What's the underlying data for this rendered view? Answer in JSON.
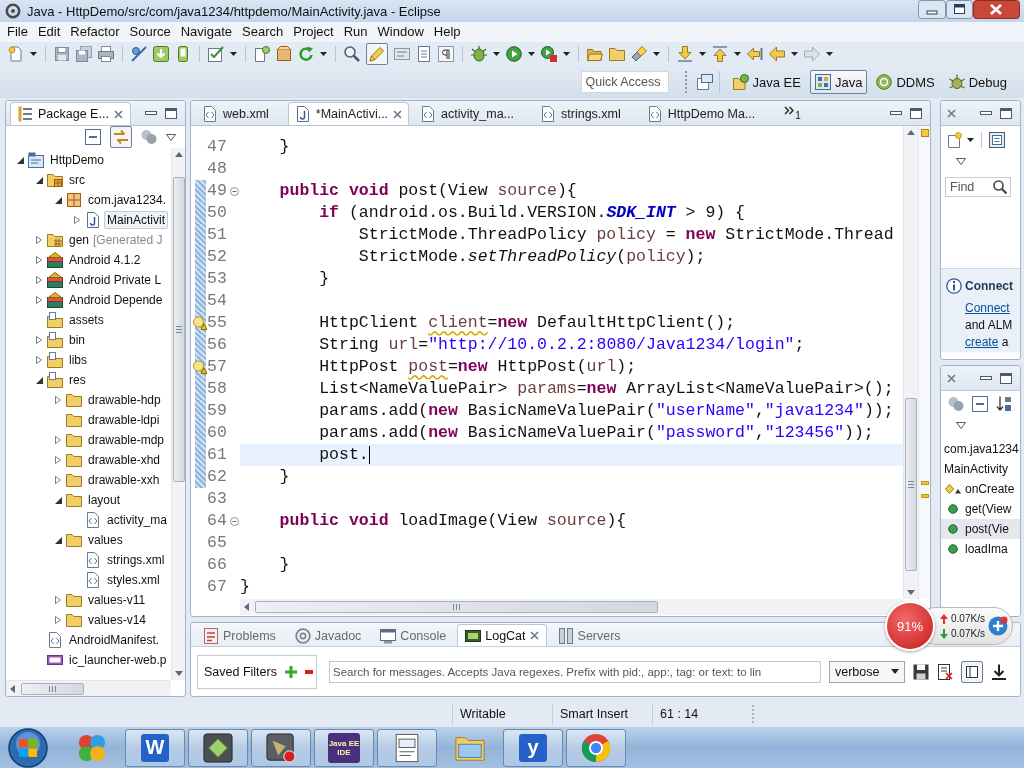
{
  "window": {
    "title": "Java - HttpDemo/src/com/java1234/httpdemo/MainActivity.java - Eclipse"
  },
  "menu": [
    "File",
    "Edit",
    "Refactor",
    "Source",
    "Navigate",
    "Search",
    "Project",
    "Run",
    "Window",
    "Help"
  ],
  "toolbar": {
    "toggle_on": true
  },
  "quick_access": {
    "placeholder": "Quick Access"
  },
  "perspectives": [
    {
      "label": "Java EE",
      "kind": "javaee",
      "selected": false
    },
    {
      "label": "Java",
      "kind": "java",
      "selected": true
    },
    {
      "label": "DDMS",
      "kind": "ddms",
      "selected": false
    },
    {
      "label": "Debug",
      "kind": "debug",
      "selected": false
    }
  ],
  "package_explorer": {
    "title": "Package E...",
    "link_toggle_on": true,
    "tree": [
      {
        "label": "HttpDemo",
        "kind": "project",
        "expanded": true,
        "selected": false,
        "children": [
          {
            "label": "src",
            "kind": "source-folder",
            "expanded": true,
            "selected": false,
            "children": [
              {
                "label": "com.java1234.",
                "kind": "package",
                "expanded": true,
                "selected": false,
                "children": [
                  {
                    "label": "MainActivit",
                    "kind": "java-file",
                    "expanded": false,
                    "selected": true
                  }
                ]
              }
            ]
          },
          {
            "label": "gen",
            "note": "[Generated J",
            "kind": "generated-folder",
            "expanded": false,
            "selected": false
          },
          {
            "label": "Android 4.1.2",
            "kind": "library",
            "expanded": false,
            "selected": false
          },
          {
            "label": "Android Private L",
            "kind": "library",
            "expanded": false,
            "selected": false
          },
          {
            "label": "Android Depende",
            "kind": "library",
            "expanded": false,
            "selected": false
          },
          {
            "label": "assets",
            "kind": "resource-folder",
            "selected": false
          },
          {
            "label": "bin",
            "kind": "resource-folder",
            "expanded": false,
            "selected": false
          },
          {
            "label": "libs",
            "kind": "resource-folder",
            "expanded": false,
            "selected": false
          },
          {
            "label": "res",
            "kind": "resource-folder",
            "expanded": true,
            "selected": false,
            "children": [
              {
                "label": "drawable-hdp",
                "kind": "folder",
                "expanded": false,
                "selected": false
              },
              {
                "label": "drawable-ldpi",
                "kind": "folder",
                "selected": false
              },
              {
                "label": "drawable-mdp",
                "kind": "folder",
                "expanded": false,
                "selected": false
              },
              {
                "label": "drawable-xhd",
                "kind": "folder",
                "expanded": false,
                "selected": false
              },
              {
                "label": "drawable-xxh",
                "kind": "folder",
                "expanded": false,
                "selected": false
              },
              {
                "label": "layout",
                "kind": "folder",
                "expanded": true,
                "selected": false,
                "children": [
                  {
                    "label": "activity_ma",
                    "kind": "xml-file",
                    "selected": false
                  }
                ]
              },
              {
                "label": "values",
                "kind": "folder",
                "expanded": true,
                "selected": false,
                "children": [
                  {
                    "label": "strings.xml",
                    "kind": "xml-file",
                    "selected": false
                  },
                  {
                    "label": "styles.xml",
                    "kind": "xml-file",
                    "selected": false
                  }
                ]
              },
              {
                "label": "values-v11",
                "kind": "folder",
                "expanded": false,
                "selected": false
              },
              {
                "label": "values-v14",
                "kind": "folder",
                "expanded": false,
                "selected": false
              }
            ]
          },
          {
            "label": "AndroidManifest.",
            "kind": "xml-file",
            "selected": false
          },
          {
            "label": "ic_launcher-web.p",
            "kind": "png-file",
            "selected": false
          }
        ]
      }
    ]
  },
  "editor": {
    "tabs": [
      {
        "label": "web.xml",
        "kind": "xml",
        "selected": false
      },
      {
        "label": "*MainActivi...",
        "kind": "java",
        "selected": true
      },
      {
        "label": "activity_ma...",
        "kind": "xml",
        "selected": false
      },
      {
        "label": "strings.xml",
        "kind": "xml",
        "selected": false
      },
      {
        "label": "HttpDemo Ma...",
        "kind": "xml",
        "selected": false
      }
    ],
    "overflow_count": "1",
    "lines": [
      {
        "number": "47",
        "changed": false,
        "foldable": false,
        "warning": false,
        "current": false,
        "segments": [
          {
            "kind": "plain",
            "text": "    }"
          }
        ]
      },
      {
        "number": "48",
        "changed": false,
        "foldable": false,
        "warning": false,
        "current": false
      },
      {
        "number": "49",
        "changed": true,
        "foldable": true,
        "warning": false,
        "current": false,
        "segments": [
          {
            "kind": "keyword",
            "text": "    public void"
          },
          {
            "kind": "plain",
            "text": " post(View "
          },
          {
            "kind": "variable",
            "text": "source"
          },
          {
            "kind": "plain",
            "text": "){"
          }
        ]
      },
      {
        "number": "50",
        "changed": true,
        "foldable": false,
        "warning": false,
        "current": false,
        "segments": [
          {
            "kind": "keyword",
            "text": "        if"
          },
          {
            "kind": "plain",
            "text": " (android.os.Build.VERSION."
          },
          {
            "kind": "constant",
            "text": "SDK_INT"
          },
          {
            "kind": "plain",
            "text": " > 9) {"
          }
        ]
      },
      {
        "number": "51",
        "changed": true,
        "foldable": false,
        "warning": false,
        "current": false,
        "segments": [
          {
            "kind": "plain",
            "text": "            StrictMode.ThreadPolicy "
          },
          {
            "kind": "variable",
            "text": "policy"
          },
          {
            "kind": "plain",
            "text": " = "
          },
          {
            "kind": "keyword",
            "text": "new"
          },
          {
            "kind": "plain",
            "text": " StrictMode.Thread"
          }
        ]
      },
      {
        "number": "52",
        "changed": true,
        "foldable": false,
        "warning": false,
        "current": false,
        "segments": [
          {
            "kind": "plain",
            "text": "            StrictMode."
          },
          {
            "kind": "static-call",
            "text": "setThreadPolicy"
          },
          {
            "kind": "plain",
            "text": "("
          },
          {
            "kind": "variable",
            "text": "policy"
          },
          {
            "kind": "plain",
            "text": ");"
          }
        ]
      },
      {
        "number": "53",
        "changed": true,
        "foldable": false,
        "warning": false,
        "current": false,
        "segments": [
          {
            "kind": "plain",
            "text": "        }"
          }
        ]
      },
      {
        "number": "54",
        "changed": true,
        "foldable": false,
        "warning": false,
        "current": false
      },
      {
        "number": "55",
        "changed": true,
        "foldable": false,
        "warning": true,
        "current": false,
        "segments": [
          {
            "kind": "plain",
            "text": "        HttpClient "
          },
          {
            "kind": "flagged-variable",
            "text": "client"
          },
          {
            "kind": "plain",
            "text": "="
          },
          {
            "kind": "keyword",
            "text": "new"
          },
          {
            "kind": "plain",
            "text": " DefaultHttpClient();"
          }
        ]
      },
      {
        "number": "56",
        "changed": true,
        "foldable": false,
        "warning": false,
        "current": false,
        "segments": [
          {
            "kind": "plain",
            "text": "        String "
          },
          {
            "kind": "variable",
            "text": "url"
          },
          {
            "kind": "plain",
            "text": "="
          },
          {
            "kind": "string",
            "text": "\"http://10.0.2.2:8080/Java1234/login\""
          },
          {
            "kind": "plain",
            "text": ";"
          }
        ]
      },
      {
        "number": "57",
        "changed": true,
        "foldable": false,
        "warning": true,
        "current": false,
        "segments": [
          {
            "kind": "plain",
            "text": "        HttpPost "
          },
          {
            "kind": "flagged-variable",
            "text": "post"
          },
          {
            "kind": "plain",
            "text": "="
          },
          {
            "kind": "keyword",
            "text": "new"
          },
          {
            "kind": "plain",
            "text": " HttpPost("
          },
          {
            "kind": "variable",
            "text": "url"
          },
          {
            "kind": "plain",
            "text": ");"
          }
        ]
      },
      {
        "number": "58",
        "changed": true,
        "foldable": false,
        "warning": false,
        "current": false,
        "segments": [
          {
            "kind": "plain",
            "text": "        List<NameValuePair> "
          },
          {
            "kind": "variable",
            "text": "params"
          },
          {
            "kind": "plain",
            "text": "="
          },
          {
            "kind": "keyword",
            "text": "new"
          },
          {
            "kind": "plain",
            "text": " ArrayList<NameValuePair>();"
          }
        ]
      },
      {
        "number": "59",
        "changed": true,
        "foldable": false,
        "warning": false,
        "current": false,
        "segments": [
          {
            "kind": "plain",
            "text": "        params.add("
          },
          {
            "kind": "keyword",
            "text": "new"
          },
          {
            "kind": "plain",
            "text": " BasicNameValuePair("
          },
          {
            "kind": "string",
            "text": "\"userName\""
          },
          {
            "kind": "plain",
            "text": ","
          },
          {
            "kind": "string",
            "text": "\"java1234\""
          },
          {
            "kind": "plain",
            "text": "));"
          }
        ]
      },
      {
        "number": "60",
        "changed": true,
        "foldable": false,
        "warning": false,
        "current": false,
        "segments": [
          {
            "kind": "plain",
            "text": "        params.add("
          },
          {
            "kind": "keyword",
            "text": "new"
          },
          {
            "kind": "plain",
            "text": " BasicNameValuePair("
          },
          {
            "kind": "string",
            "text": "\"password\""
          },
          {
            "kind": "plain",
            "text": ","
          },
          {
            "kind": "string",
            "text": "\"123456\""
          },
          {
            "kind": "plain",
            "text": "));"
          }
        ]
      },
      {
        "number": "61",
        "changed": true,
        "foldable": false,
        "warning": false,
        "current": true,
        "segments": [
          {
            "kind": "plain",
            "text": "        post."
          }
        ]
      },
      {
        "number": "62",
        "changed": true,
        "foldable": false,
        "warning": false,
        "current": false,
        "segments": [
          {
            "kind": "plain",
            "text": "    }"
          }
        ]
      },
      {
        "number": "63",
        "changed": false,
        "foldable": false,
        "warning": false,
        "current": false
      },
      {
        "number": "64",
        "changed": false,
        "foldable": true,
        "warning": false,
        "current": false,
        "segments": [
          {
            "kind": "keyword",
            "text": "    public void"
          },
          {
            "kind": "plain",
            "text": " loadImage(View "
          },
          {
            "kind": "variable",
            "text": "source"
          },
          {
            "kind": "plain",
            "text": "){"
          }
        ]
      },
      {
        "number": "65",
        "changed": false,
        "foldable": false,
        "warning": false,
        "current": false
      },
      {
        "number": "66",
        "changed": false,
        "foldable": false,
        "warning": false,
        "current": false,
        "segments": [
          {
            "kind": "plain",
            "text": "    }"
          }
        ]
      },
      {
        "number": "67",
        "changed": false,
        "foldable": false,
        "warning": false,
        "current": false,
        "segments": [
          {
            "kind": "plain",
            "text": "}"
          }
        ]
      }
    ]
  },
  "tasks_view": {
    "find_placeholder": "Find",
    "connect": {
      "heading": "Connect",
      "lines": [
        [
          {
            "text": "Connect",
            "link": true
          }
        ],
        [
          {
            "text": "and ALM",
            "link": false
          }
        ],
        [
          {
            "text": "create",
            "link": true
          },
          {
            "text": "a",
            "link": false
          }
        ]
      ]
    }
  },
  "outline": {
    "items": [
      {
        "label": "com.java1234",
        "kind": "text",
        "selected": false
      },
      {
        "label": "MainActivity",
        "kind": "text",
        "selected": false
      },
      {
        "label": "onCreate",
        "kind": "override-method",
        "selected": false
      },
      {
        "label": "get(View",
        "kind": "method",
        "selected": false
      },
      {
        "label": "post(Vie",
        "kind": "method",
        "selected": true
      },
      {
        "label": "loadIma",
        "kind": "method",
        "selected": false
      }
    ]
  },
  "bottom_panel": {
    "tabs": [
      {
        "label": "Problems",
        "kind": "problems",
        "selected": false
      },
      {
        "label": "Javadoc",
        "kind": "javadoc",
        "selected": false
      },
      {
        "label": "Console",
        "kind": "console",
        "selected": false
      },
      {
        "label": "LogCat",
        "kind": "logcat",
        "selected": true
      },
      {
        "label": "Servers",
        "kind": "servers",
        "selected": false
      }
    ],
    "logcat": {
      "saved_filters": "Saved Filters",
      "search_placeholder": "Search for messages. Accepts Java regexes. Prefix with pid:, app:, tag: or text: to lin",
      "level": "verbose",
      "pane_toggle_on": true
    }
  },
  "status_bar": [
    "Writable",
    "Smart Insert",
    "61 : 14"
  ],
  "speed_widget": {
    "percent": "91%",
    "upload": "0.07K/s",
    "download": "0.07K/s"
  },
  "taskbar": {
    "apps": [
      {
        "kind": "circles",
        "running": false
      },
      {
        "kind": "letter",
        "label": "W",
        "running": true
      },
      {
        "kind": "slate-diamond",
        "running": true
      },
      {
        "kind": "slate-dot",
        "running": true
      },
      {
        "kind": "badge",
        "label": "Java EE IDE",
        "running": true
      },
      {
        "kind": "document",
        "running": true
      },
      {
        "kind": "folder",
        "running": false
      },
      {
        "kind": "letter",
        "label": "y",
        "running": true
      },
      {
        "kind": "tricolor",
        "running": true
      }
    ]
  }
}
